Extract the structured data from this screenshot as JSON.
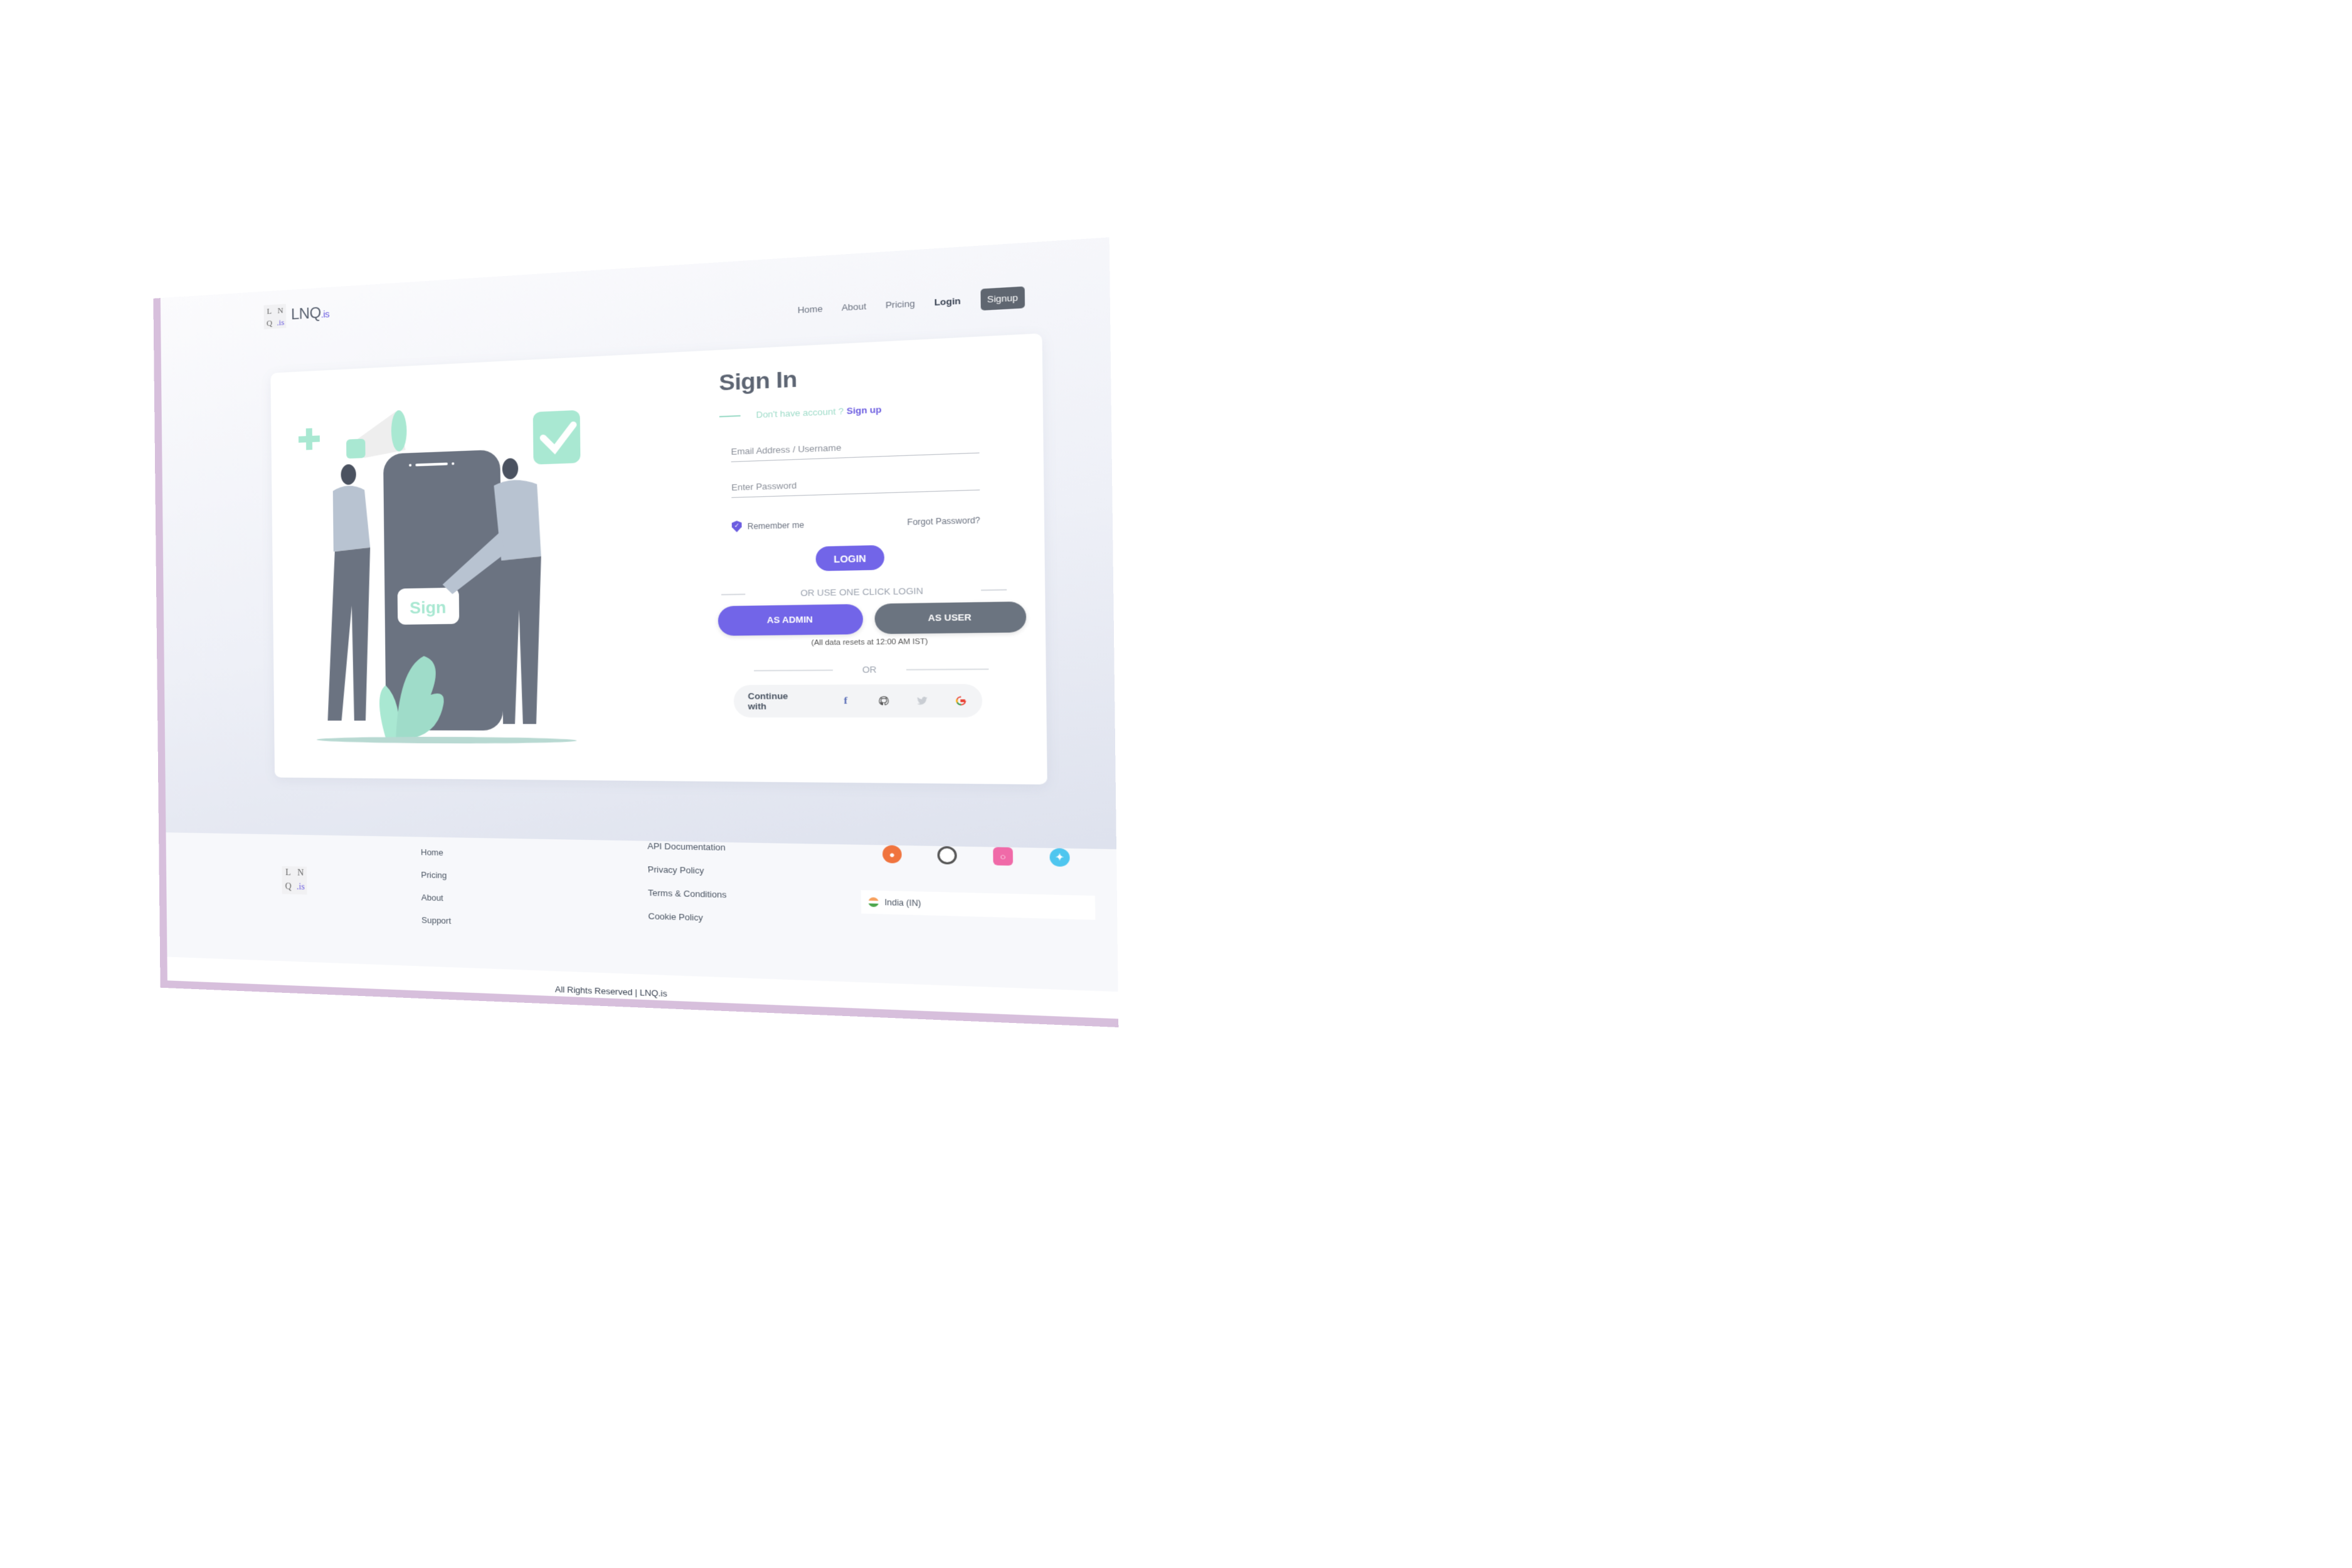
{
  "brand": {
    "logo_tiles": [
      "L",
      "N",
      "Q",
      ".is"
    ],
    "name": "LNQ",
    "suffix": ".is",
    "accent": "#6b5ce0"
  },
  "nav": {
    "items": [
      "Home",
      "About",
      "Pricing"
    ],
    "login": "Login",
    "signup": "Signup"
  },
  "illustration": {
    "sign_label": "Sign"
  },
  "signin": {
    "title": "Sign In",
    "no_account": "Don't have account ?",
    "signup_link": "Sign up",
    "email_placeholder": "Email Address / Username",
    "password_placeholder": "Enter Password",
    "remember_me": "Remember me",
    "forgot_password": "Forgot Password?",
    "login_button": "LOGIN",
    "one_click_label": "OR USE ONE CLICK LOGIN",
    "as_admin": "AS ADMIN",
    "as_user": "AS USER",
    "reset_note": "(All data resets at 12:00 AM IST)",
    "or_label": "OR",
    "continue_with": "Continue with",
    "providers": [
      "facebook-icon",
      "github-icon",
      "twitter-icon",
      "google-icon"
    ]
  },
  "footer": {
    "col1": [
      "Home",
      "Pricing",
      "About",
      "Support"
    ],
    "col2": [
      "API Documentation",
      "Privacy Policy",
      "Terms & Conditions",
      "Cookie Policy"
    ],
    "social": [
      "reddit-icon",
      "github-icon",
      "instagram-icon",
      "twitter-icon"
    ],
    "country": "India (IN)",
    "copyright": "All Rights Reserved | LNQ.is"
  },
  "colors": {
    "primary": "#7265e8",
    "secondary": "#6b7480",
    "mint": "#9fdcc9",
    "frame": "#d7bfdc"
  }
}
